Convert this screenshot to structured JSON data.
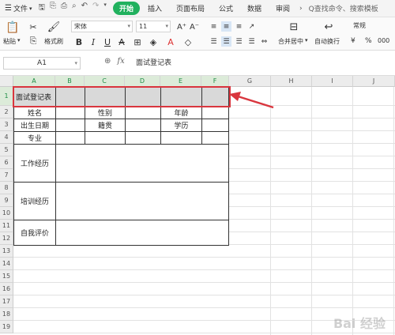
{
  "tabbar": {
    "file_menu": "文件",
    "tabs": [
      "开始",
      "插入",
      "页面布局",
      "公式",
      "数据",
      "审阅"
    ],
    "active_tab": "开始",
    "more": "›",
    "search_placeholder": "Q查找命令、搜索模板"
  },
  "ribbon": {
    "paste_label": "粘贴",
    "format_painter_label": "格式刷",
    "font_name": "宋体",
    "font_size": "11",
    "merge_label": "合并居中",
    "wrap_label": "自动换行",
    "number_format": "常规",
    "currency_symbol": "¥",
    "percent_symbol": "%",
    "thousands": "000"
  },
  "formula_bar": {
    "name_box": "A1",
    "formula": "面试登记表"
  },
  "columns": [
    "A",
    "B",
    "C",
    "D",
    "E",
    "F",
    "G",
    "H",
    "I",
    "J"
  ],
  "rows": [
    "1",
    "2",
    "3",
    "4",
    "5",
    "6",
    "7",
    "8",
    "9",
    "10",
    "11",
    "12",
    "13",
    "14",
    "15",
    "16",
    "17",
    "18",
    "19"
  ],
  "cells": {
    "a1": "面试登记表",
    "a2": "姓名",
    "c2": "性别",
    "e2": "年龄",
    "a3": "出生日期",
    "c3": "籍贯",
    "e3": "学历",
    "a4": "专业",
    "a5": "工作经历",
    "a8": "培训经历",
    "a11": "自我评价"
  },
  "watermark": "Bai 经验"
}
